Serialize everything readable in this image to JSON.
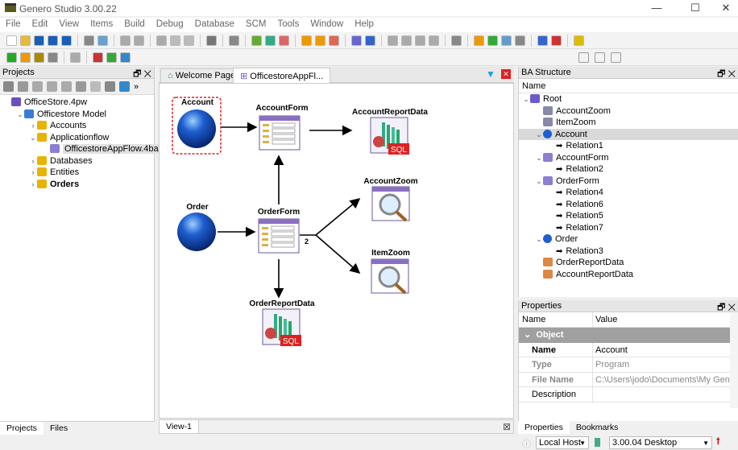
{
  "window": {
    "title": "Genero Studio 3.00.22"
  },
  "menu": [
    "File",
    "Edit",
    "View",
    "Items",
    "Build",
    "Debug",
    "Database",
    "SCM",
    "Tools",
    "Window",
    "Help"
  ],
  "projects": {
    "title": "Projects",
    "tree": [
      {
        "label": "OfficeStore.4pw",
        "level": 0,
        "color": "#6b4fbf"
      },
      {
        "label": "Officestore Model",
        "level": 1,
        "color": "#3a7bd5",
        "toggle": "⌄"
      },
      {
        "label": "Accounts",
        "level": 2,
        "color": "#e8b400",
        "toggle": "›"
      },
      {
        "label": "Applicationflow",
        "level": 2,
        "color": "#e8b400",
        "toggle": "⌄"
      },
      {
        "label": "OfficestoreAppFlow.4ba",
        "level": 3,
        "color": "#8a7fd1",
        "selected": true
      },
      {
        "label": "Databases",
        "level": 2,
        "color": "#e8b400",
        "toggle": "›"
      },
      {
        "label": "Entities",
        "level": 2,
        "color": "#e8b400",
        "toggle": "›"
      },
      {
        "label": "Orders",
        "level": 2,
        "color": "#e8b400",
        "toggle": "›",
        "bold": true
      }
    ],
    "tabs": [
      "Projects",
      "Files"
    ]
  },
  "editor": {
    "tabs": [
      "Welcome Page",
      "OfficestoreAppFl..."
    ],
    "view_tab": "View-1",
    "nodes": {
      "account": "Account",
      "account_form": "AccountForm",
      "account_report": "AccountReportData",
      "order": "Order",
      "order_form": "OrderForm",
      "account_zoom": "AccountZoom",
      "item_zoom": "ItemZoom",
      "order_report": "OrderReportData"
    },
    "branch_count": "2",
    "sql_label": "SQL"
  },
  "ba_structure": {
    "title": "BA Structure",
    "column": "Name",
    "tree": [
      {
        "label": "Root",
        "level": 0,
        "toggle": "⌄",
        "icon": "root"
      },
      {
        "label": "AccountZoom",
        "level": 1,
        "icon": "zoom"
      },
      {
        "label": "ItemZoom",
        "level": 1,
        "icon": "zoom"
      },
      {
        "label": "Account",
        "level": 1,
        "toggle": "⌄",
        "icon": "program",
        "selected": true
      },
      {
        "label": "Relation1",
        "level": 2,
        "icon": "arrow"
      },
      {
        "label": "AccountForm",
        "level": 1,
        "toggle": "⌄",
        "icon": "form"
      },
      {
        "label": "Relation2",
        "level": 2,
        "icon": "arrow"
      },
      {
        "label": "OrderForm",
        "level": 1,
        "toggle": "⌄",
        "icon": "form"
      },
      {
        "label": "Relation4",
        "level": 2,
        "icon": "arrow"
      },
      {
        "label": "Relation6",
        "level": 2,
        "icon": "arrow"
      },
      {
        "label": "Relation5",
        "level": 2,
        "icon": "arrow"
      },
      {
        "label": "Relation7",
        "level": 2,
        "icon": "arrow"
      },
      {
        "label": "Order",
        "level": 1,
        "toggle": "⌄",
        "icon": "program"
      },
      {
        "label": "Relation3",
        "level": 2,
        "icon": "arrow"
      },
      {
        "label": "OrderReportData",
        "level": 1,
        "icon": "report"
      },
      {
        "label": "AccountReportData",
        "level": 1,
        "icon": "report"
      }
    ]
  },
  "properties": {
    "title": "Properties",
    "col_name": "Name",
    "col_value": "Value",
    "group": "Object",
    "rows": [
      {
        "k": "Name",
        "v": "Account",
        "bold": true
      },
      {
        "k": "Type",
        "v": "Program",
        "dim": true
      },
      {
        "k": "File Name",
        "v": "C:\\Users\\jodo\\Documents\\My Gene...",
        "dim": true
      },
      {
        "k": "Description",
        "v": ""
      }
    ],
    "tabs": [
      "Properties",
      "Bookmarks"
    ]
  },
  "status": {
    "host": "Local Host",
    "version": "3.00.04 Desktop"
  }
}
